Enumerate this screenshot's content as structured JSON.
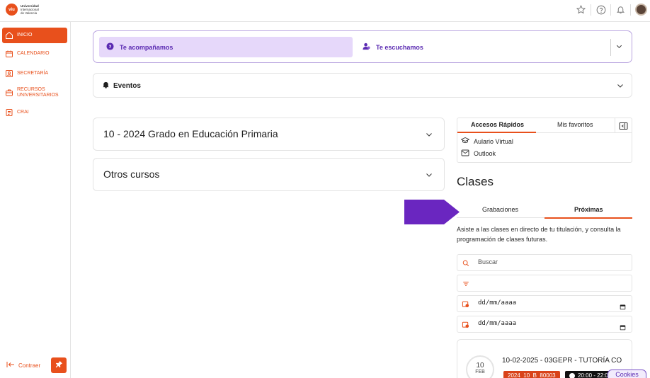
{
  "header": {
    "logo": {
      "badge": "viu",
      "line1": "Universidad",
      "line2": "Internacional",
      "line3": "de Valencia"
    },
    "icons": [
      "star-icon",
      "help-icon",
      "bell-icon"
    ]
  },
  "sidebar": {
    "items": [
      {
        "label": "INICIO",
        "icon": "home-icon",
        "active": true
      },
      {
        "label": "CALENDARIO",
        "icon": "calendar-icon",
        "active": false
      },
      {
        "label": "SECRETARÍA",
        "icon": "id-card-icon",
        "active": false
      },
      {
        "label": "RECURSOS UNIVERSITARIOS",
        "icon": "briefcase-icon",
        "active": false
      },
      {
        "label": "CRAI",
        "icon": "document-icon",
        "active": false
      }
    ],
    "collapse_label": "Contraer"
  },
  "support": {
    "tab1": "Te acompañamos",
    "tab2": "Te escuchamos"
  },
  "events": {
    "title": "Eventos"
  },
  "courses": [
    {
      "title": "10 - 2024 Grado en Educación Primaria"
    },
    {
      "title": "Otros cursos"
    }
  ],
  "quick_access": {
    "tab_active": "Accesos Rápidos",
    "tab_favorites": "Mis favoritos",
    "links": [
      {
        "label": "Aulario Virtual",
        "icon": "graduation-cap-icon"
      },
      {
        "label": "Outlook",
        "icon": "mail-icon"
      }
    ]
  },
  "clases": {
    "title": "Clases",
    "tabs": [
      "Grabaciones",
      "Próximas"
    ],
    "active_tab": "Próximas",
    "description": "Asiste a las clases en directo de tu titulación, y consulta la programación de clases futuras.",
    "search_placeholder": "Buscar",
    "date_from": "dd/mm/aaaa",
    "date_to": "dd/mm/aaaa",
    "upcoming": {
      "day": "10",
      "month": "FEB",
      "title": "10-02-2025 - 03GEPR - TUTORÍA CO",
      "code": "2024_10_B_80003",
      "time": "20:00 - 22:0"
    }
  },
  "cookies_label": "Cookies",
  "colors": {
    "accent": "#e8501c",
    "purple": "#5b2bb2",
    "purple_light": "#e6d8fa",
    "arrow": "#6a26c0"
  }
}
